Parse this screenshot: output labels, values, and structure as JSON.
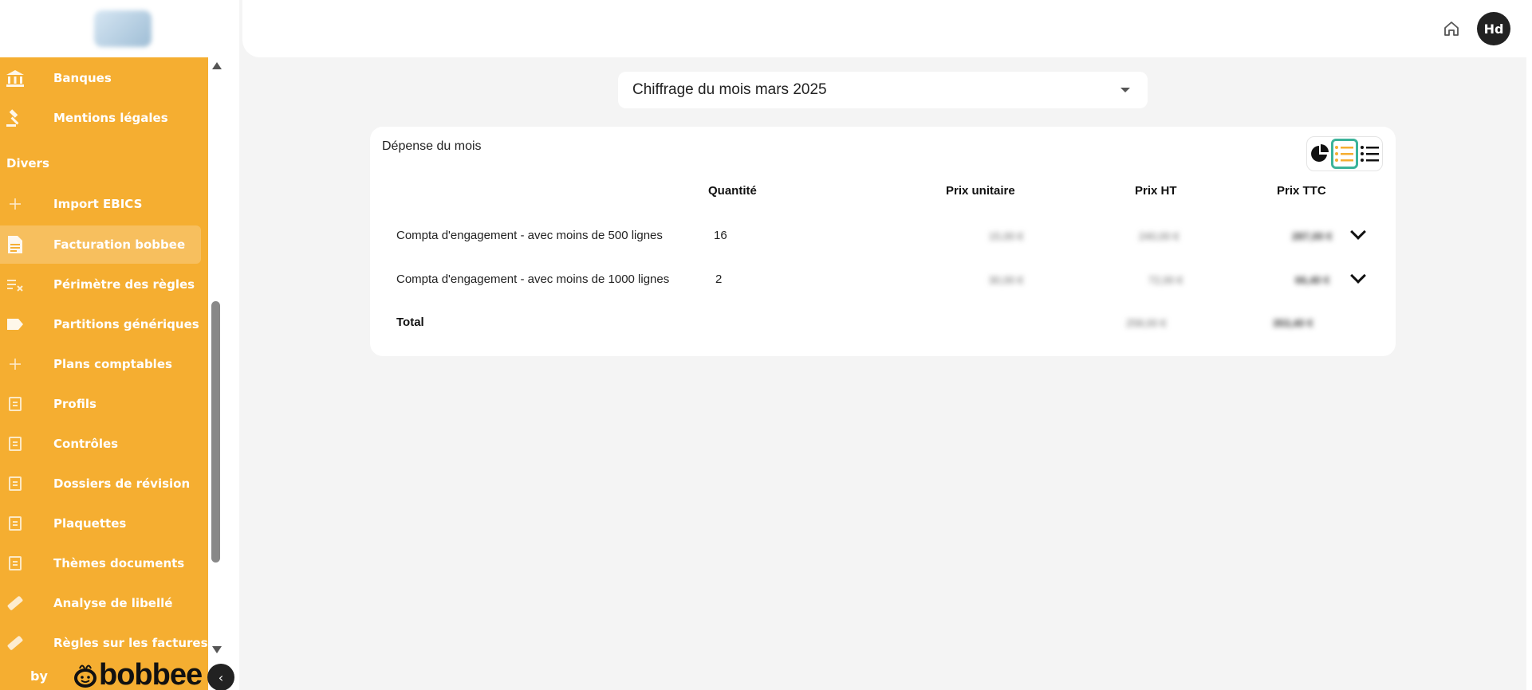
{
  "sidebar": {
    "items": [
      {
        "label": "Banques",
        "icon": "bank-icon"
      },
      {
        "label": "Mentions légales",
        "icon": "gavel-icon"
      },
      {
        "label": "Import EBICS",
        "icon": "plus-icon"
      },
      {
        "label": "Facturation bobbee",
        "icon": "invoice-icon",
        "active": true
      },
      {
        "label": "Périmètre des règles",
        "icon": "rules-icon"
      },
      {
        "label": "Partitions génériques",
        "icon": "label-icon"
      },
      {
        "label": "Plans comptables",
        "icon": "plus-icon"
      },
      {
        "label": "Profils",
        "icon": "list-icon"
      },
      {
        "label": "Contrôles",
        "icon": "list-icon"
      },
      {
        "label": "Dossiers de révision",
        "icon": "list-icon"
      },
      {
        "label": "Plaquettes",
        "icon": "list-icon"
      },
      {
        "label": "Thèmes documents",
        "icon": "list-icon"
      },
      {
        "label": "Analyse de libellé",
        "icon": "pen-icon"
      },
      {
        "label": "Règles sur les factures",
        "icon": "pen-icon"
      }
    ],
    "section_divers": "Divers",
    "footer_by": "by",
    "brand": "bobbee",
    "collapse_icon": "chevron-left-icon",
    "accent": "#f5ae31"
  },
  "header": {
    "home_icon": "home-icon",
    "avatar_initials": "Hd"
  },
  "month_select": {
    "value": "Chiffrage du mois mars 2025"
  },
  "card": {
    "title": "Dépense du mois",
    "view_toggle": [
      "pie-chart-icon",
      "list-icon",
      "list-bullets-icon"
    ],
    "active_view_color": "#3bb39a",
    "columns": {
      "quantity": "Quantité",
      "unit_price": "Prix unitaire",
      "price_ht": "Prix HT",
      "price_ttc": "Prix TTC"
    },
    "rows": [
      {
        "label": "Compta d'engagement - avec moins de 500 lignes",
        "quantity": "16",
        "unit_price": "15,00 €",
        "price_ht": "240,00 €",
        "price_ttc": "287,00 €"
      },
      {
        "label": "Compta d'engagement - avec moins de 1000 lignes",
        "quantity": "2",
        "unit_price": "30,00 €",
        "price_ht": "72,00 €",
        "price_ttc": "66,40 €"
      }
    ],
    "total": {
      "label": "Total",
      "price_ht": "258,00 €",
      "price_ttc": "353,40 €"
    }
  }
}
